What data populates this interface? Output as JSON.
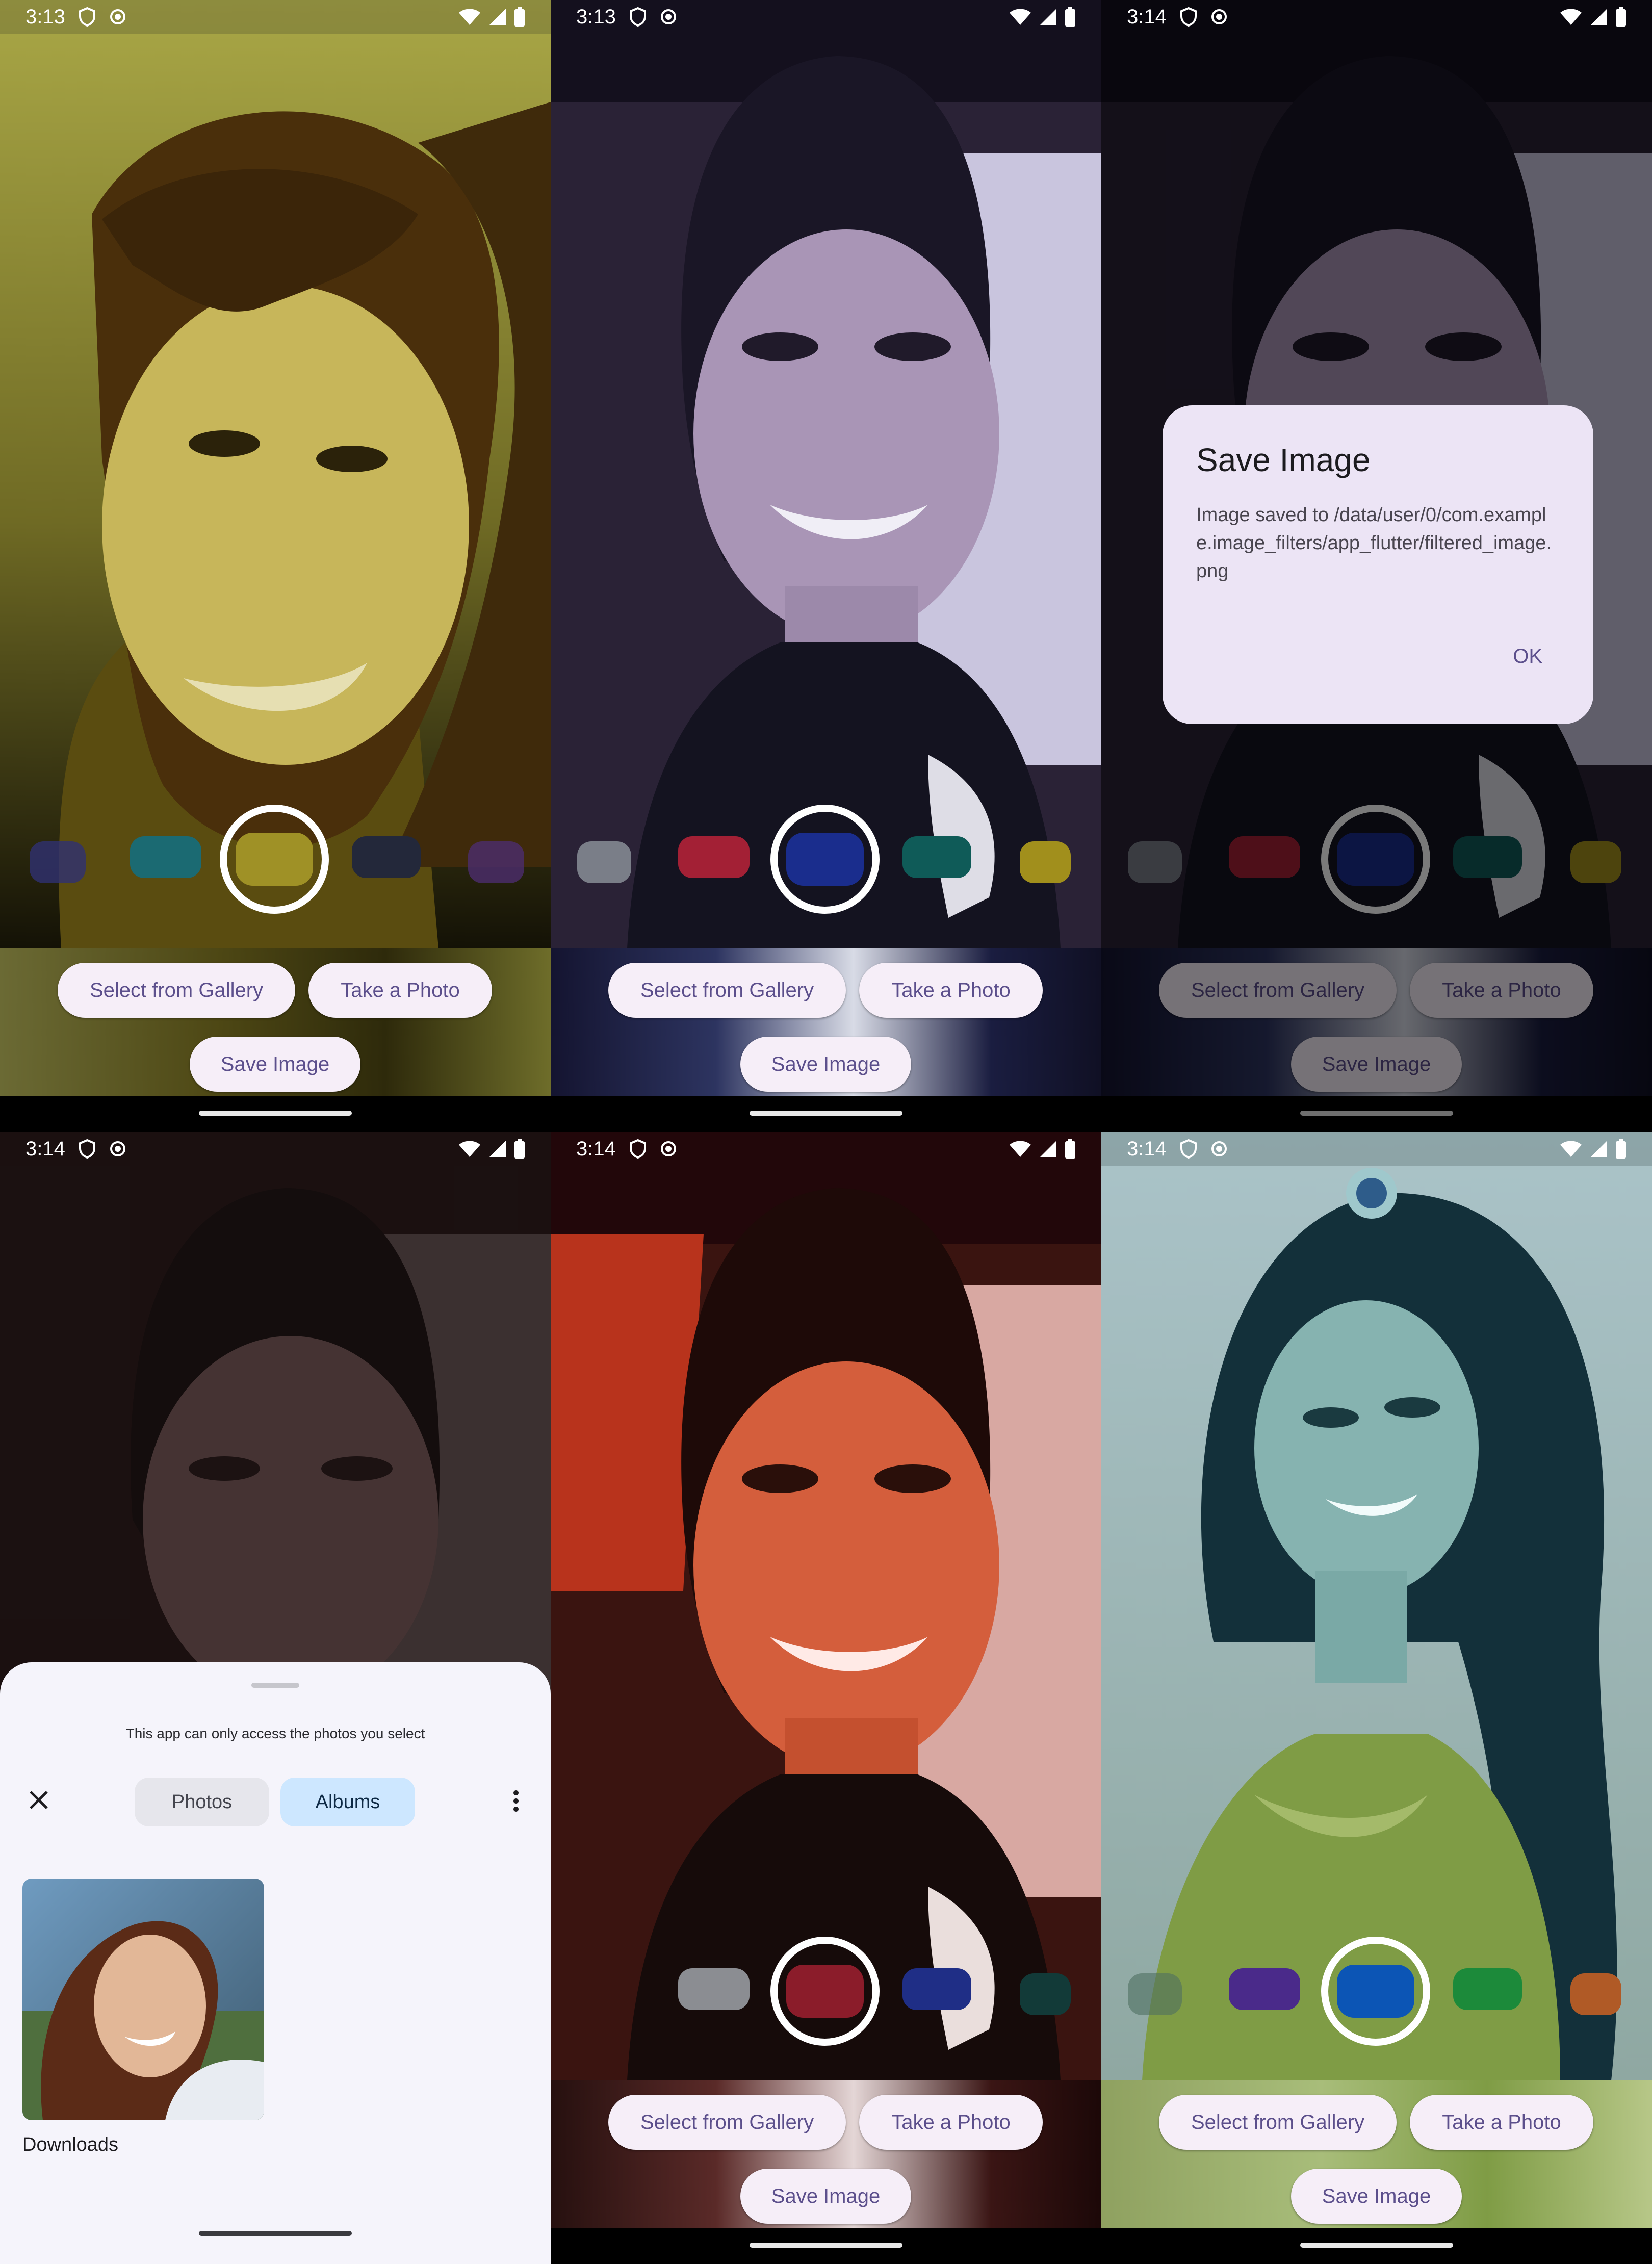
{
  "status": {
    "p1_time": "3:13",
    "p2_time": "3:13",
    "p3_time": "3:14",
    "p4_time": "3:14",
    "p5_time": "3:14",
    "p6_time": "3:14"
  },
  "buttons": {
    "gallery": "Select from Gallery",
    "camera": "Take a Photo",
    "save": "Save Image"
  },
  "dialog": {
    "title": "Save Image",
    "message": "Image saved to /data/user/0/com.example.image_filters/app_flutter/filtered_image.png",
    "ok": "OK"
  },
  "picker": {
    "notice": "This app can only access the photos you select",
    "tab_photos": "Photos",
    "tab_albums": "Albums",
    "album_name": "Downloads"
  },
  "colors": {
    "button_bg": "#f6eef8",
    "button_text": "#5c4f8c",
    "filter_yellow": "#bfae2c",
    "filter_blue": "#1f3fa4",
    "filter_red": "#b1223a",
    "filter_teal": "#1b7a7f",
    "selected_tab": "#cde7ff"
  },
  "icons": [
    "shield-icon",
    "circle-icon",
    "wifi-icon",
    "signal-icon",
    "battery-icon",
    "close-icon",
    "more-vert-icon"
  ]
}
